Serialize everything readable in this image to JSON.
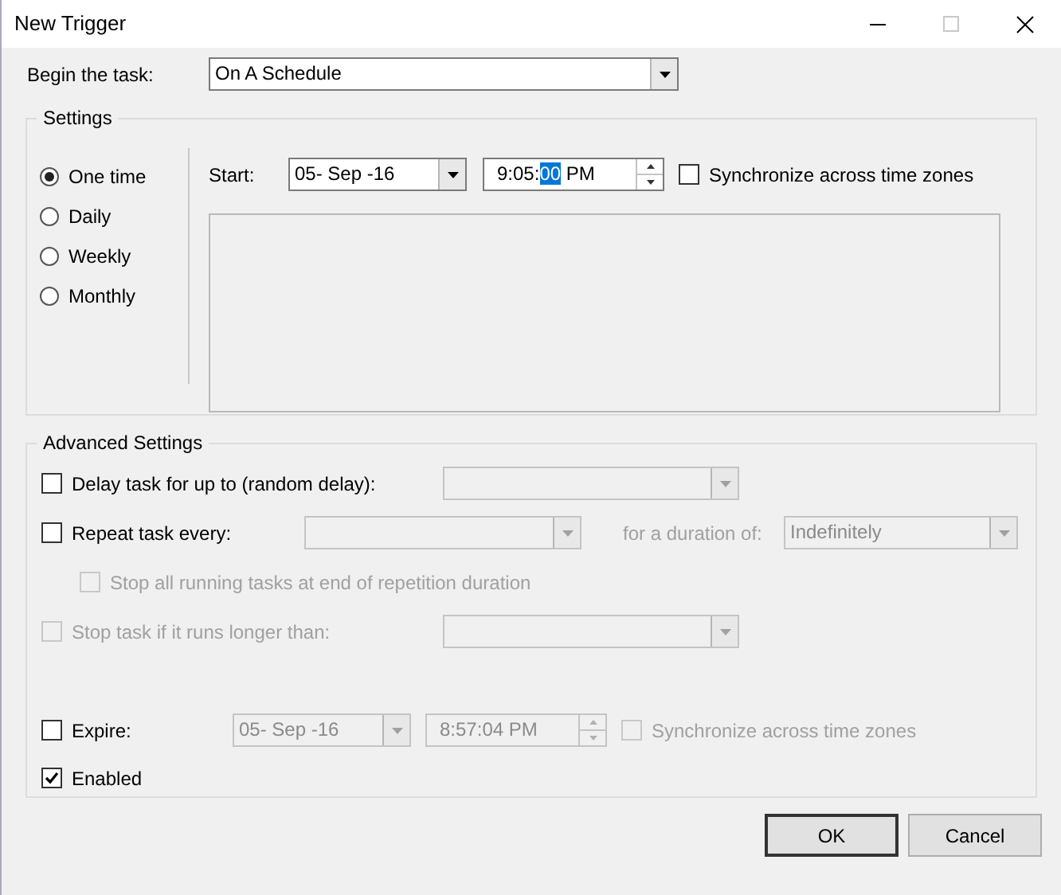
{
  "window": {
    "title": "New Trigger",
    "controls": [
      {
        "kind": "minimize",
        "disabled": false
      },
      {
        "kind": "maximize",
        "disabled": true
      },
      {
        "kind": "close",
        "disabled": false
      }
    ]
  },
  "begin_task": {
    "label": "Begin the task:",
    "value": "On A Schedule"
  },
  "settings": {
    "title": "Settings",
    "schedule_options": [
      {
        "label": "One time",
        "selected": true
      },
      {
        "label": "Daily",
        "selected": false
      },
      {
        "label": "Weekly",
        "selected": false
      },
      {
        "label": "Monthly",
        "selected": false
      }
    ],
    "start": {
      "label": "Start:",
      "date": "05- Sep -16",
      "time_before": "9:05:",
      "time_selected": "00",
      "time_after": " PM",
      "sync": {
        "label": "Synchronize across time zones",
        "checked": false,
        "disabled": false
      }
    }
  },
  "advanced": {
    "title": "Advanced Settings",
    "delay": {
      "label": "Delay task for up to (random delay):",
      "checked": false,
      "disabled": false
    },
    "repeat": {
      "label": "Repeat task every:",
      "checked": false,
      "disabled": false,
      "duration_label": "for a duration of:",
      "duration_value": "Indefinitely"
    },
    "stop_all": {
      "label": "Stop all running tasks at end of repetition duration",
      "checked": false,
      "disabled": true
    },
    "stop_if": {
      "label": "Stop task if it runs longer than:",
      "checked": false,
      "disabled": true
    },
    "expire": {
      "label": "Expire:",
      "checked": false,
      "disabled": false,
      "date": "05- Sep -16",
      "time": "8:57:04 PM",
      "sync": {
        "label": "Synchronize across time zones",
        "checked": false,
        "disabled": true
      }
    },
    "enabled": {
      "label": "Enabled",
      "checked": true,
      "disabled": false
    }
  },
  "buttons": [
    {
      "label": "OK",
      "default": true
    },
    {
      "label": "Cancel",
      "default": false
    }
  ]
}
